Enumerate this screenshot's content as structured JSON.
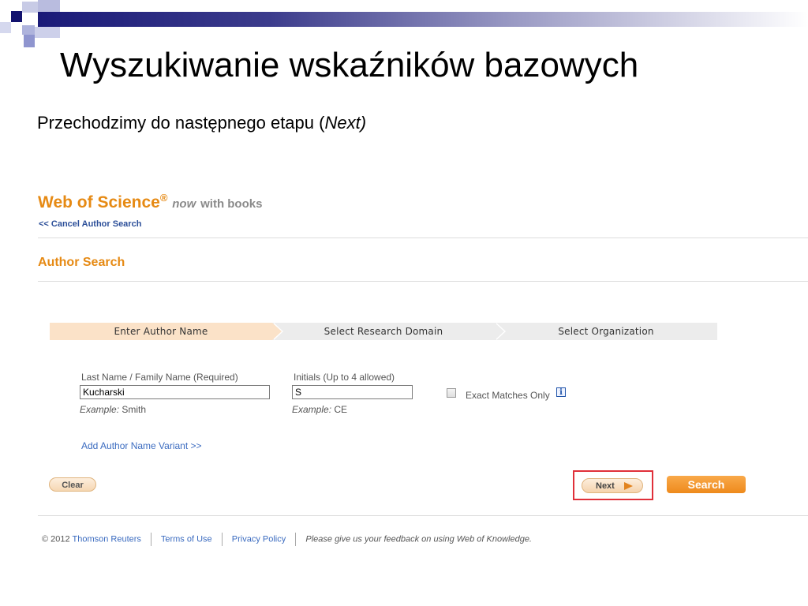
{
  "slide": {
    "title": "Wyszukiwanie wskaźników bazowych",
    "subtitle_prefix": "Przechodzimy do następnego etapu (",
    "subtitle_italic": "Next)",
    "accent_color": "#1a1a78"
  },
  "wos": {
    "brand": "Web of Science",
    "reg": "®",
    "now": "now",
    "with_books": "with books",
    "cancel_link": "<< Cancel Author Search",
    "section_title": "Author Search",
    "brand_color": "#e68a14"
  },
  "steps": [
    "Enter Author Name",
    "Select Research Domain",
    "Select Organization"
  ],
  "form": {
    "last_name_label": "Last Name / Family Name  (Required)",
    "last_name_value": "Kucharski",
    "last_name_example_label": "Example:",
    "last_name_example": "Smith",
    "initials_label": "Initials  (Up to 4 allowed)",
    "initials_value": "S",
    "initials_example_label": "Example:",
    "initials_example": "CE",
    "exact_matches_label": "Exact Matches Only",
    "exact_matches_checked": false,
    "info_icon": "i",
    "add_variant_link": "Add Author Name Variant >>"
  },
  "buttons": {
    "clear": "Clear",
    "next": "Next",
    "search": "Search",
    "highlight_color": "#e0303a"
  },
  "footer": {
    "copyright": "© 2012",
    "company": "Thomson Reuters",
    "terms": "Terms of Use",
    "privacy": "Privacy Policy",
    "feedback_pre": "Please give us your",
    "feedback_link": "feedback",
    "feedback_post": "on using Web of Knowledge."
  }
}
